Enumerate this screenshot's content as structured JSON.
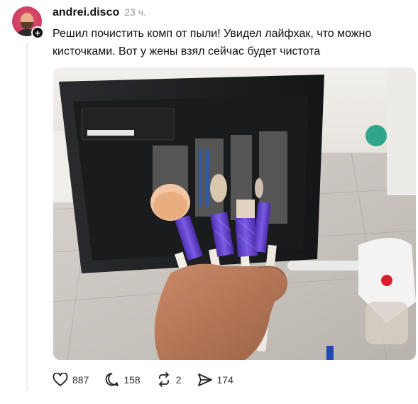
{
  "post": {
    "author": {
      "username": "andrei.disco"
    },
    "timestamp": "23 ч.",
    "text": "Решил почистить комп от пыли! Увидел лайфхак, что можно кисточками. Вот у жены взял сейчас будет чистота",
    "stats": {
      "likes": "887",
      "replies": "158",
      "reposts": "2",
      "shares": "174"
    }
  },
  "icons": {
    "like": "heart-icon",
    "reply": "speech-bubble-icon",
    "repost": "repost-arrows-icon",
    "share": "send-arrow-icon",
    "follow": "plus-icon"
  },
  "colors": {
    "text": "#101010",
    "muted": "#999999",
    "brush_handle": "#6b4bd1"
  }
}
